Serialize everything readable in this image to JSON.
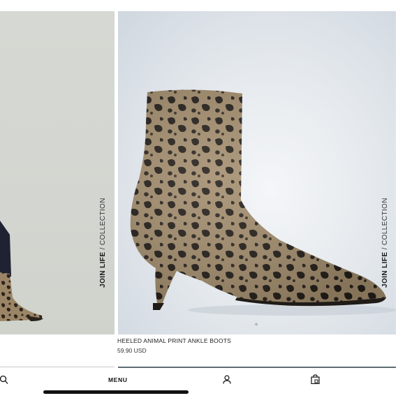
{
  "collection_tag": {
    "strong": "JOIN LIFE",
    "light": " / COLLECTION"
  },
  "product": {
    "name": "HEELED ANIMAL PRINT ANKLE BOOTS",
    "price": "59.90 USD"
  },
  "gallery": {
    "dot_glyph": "+"
  },
  "nav": {
    "menu_label": "MENU",
    "icons": [
      "search-icon",
      "user-icon",
      "shopping-bag-icon"
    ]
  },
  "colors": {
    "left_panel_bg": "#d4d7d1",
    "right_panel_bg": "#e3e8ed",
    "progress": "#5e6b73"
  }
}
